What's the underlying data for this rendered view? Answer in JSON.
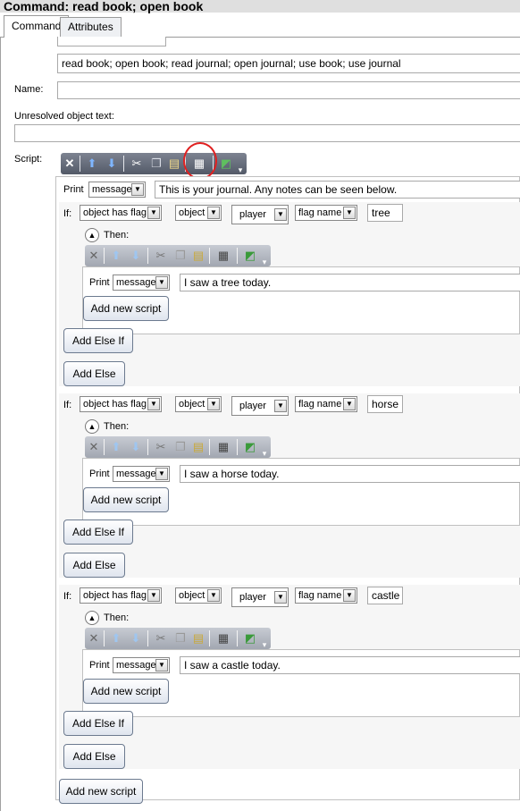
{
  "window": {
    "title": "Command: read book; open book"
  },
  "tabs": [
    {
      "label": "Command"
    },
    {
      "label": "Attributes"
    }
  ],
  "form": {
    "pattern_value": "read book; open book; read journal; open journal; use book; use journal",
    "name_label": "Name:",
    "name_value": "",
    "unresolved_label": "Unresolved object text:",
    "unresolved_value": "",
    "script_label": "Script:"
  },
  "toolbar_icons": [
    "delete-icon",
    "move-up-icon",
    "move-down-icon",
    "cut-icon",
    "copy-icon",
    "paste-icon",
    "code-view-icon",
    "popout-icon",
    "overflow-icon"
  ],
  "print_row": {
    "label": "Print",
    "type": "message",
    "value": "This is your journal. Any notes can be seen below."
  },
  "if_blocks": [
    {
      "if_label": "If:",
      "condition": "object has flag",
      "object_type": "object",
      "object": "player",
      "flag_type": "flag name",
      "flag": "tree",
      "then_label": "Then:",
      "print_label": "Print",
      "print_type": "message",
      "print_value": "I saw a tree today.",
      "add_script": "Add new script",
      "add_else_if": "Add Else If",
      "add_else": "Add Else"
    },
    {
      "if_label": "If:",
      "condition": "object has flag",
      "object_type": "object",
      "object": "player",
      "flag_type": "flag name",
      "flag": "horse",
      "then_label": "Then:",
      "print_label": "Print",
      "print_type": "message",
      "print_value": "I saw a horse today.",
      "add_script": "Add new script",
      "add_else_if": "Add Else If",
      "add_else": "Add Else"
    },
    {
      "if_label": "If:",
      "condition": "object has flag",
      "object_type": "object",
      "object": "player",
      "flag_type": "flag name",
      "flag": "castle",
      "then_label": "Then:",
      "print_label": "Print",
      "print_type": "message",
      "print_value": "I saw a castle today.",
      "add_script": "Add new script",
      "add_else_if": "Add Else If",
      "add_else": "Add Else"
    }
  ],
  "bottom": {
    "add_script": "Add new script"
  },
  "colors": {
    "annotation_circle": "#e02020",
    "toolbar_dark": "#5f6573"
  }
}
